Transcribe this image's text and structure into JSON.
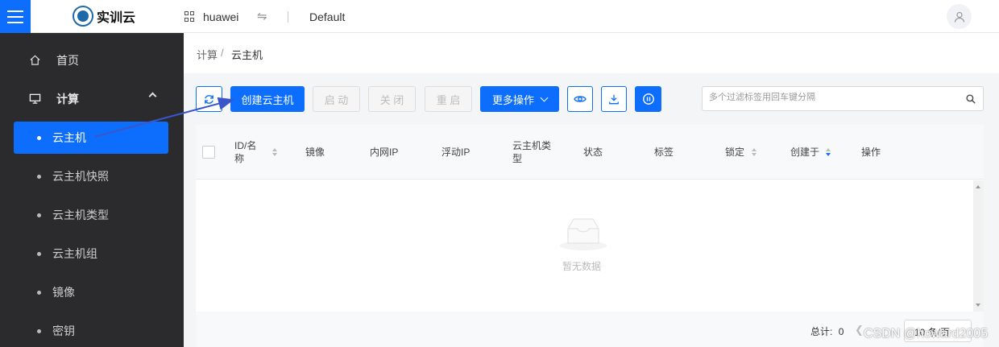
{
  "header": {
    "logo_text": "实训云",
    "project": "huawei",
    "swap_glyph": "⇋",
    "region": "Default"
  },
  "sidebar": {
    "top_items": [
      {
        "label": "首页",
        "icon": "home-icon"
      },
      {
        "label": "计算",
        "icon": "monitor-icon",
        "expanded": true
      }
    ],
    "sub_items": [
      {
        "label": "云主机",
        "active": true
      },
      {
        "label": "云主机快照"
      },
      {
        "label": "云主机类型"
      },
      {
        "label": "云主机组"
      },
      {
        "label": "镜像"
      },
      {
        "label": "密钥"
      }
    ]
  },
  "breadcrumb": {
    "items": [
      "计算",
      "云主机"
    ],
    "separator": "/"
  },
  "toolbar": {
    "refresh_icon": "refresh-icon",
    "create_label": "创建云主机",
    "start_label": "启 动",
    "stop_label": "关 闭",
    "restart_label": "重 启",
    "more_label": "更多操作",
    "eye_icon": "eye-icon",
    "download_icon": "download-icon",
    "power_icon": "power-icon"
  },
  "search": {
    "placeholder": "多个过滤标签用回车键分隔"
  },
  "table": {
    "columns": [
      {
        "label": "ID/名",
        "label2": "称",
        "sortable": true
      },
      {
        "label": "镜像"
      },
      {
        "label": "内网IP"
      },
      {
        "label": "浮动IP"
      },
      {
        "label": "云主机类",
        "label2": "型"
      },
      {
        "label": "状态"
      },
      {
        "label": "标签"
      },
      {
        "label": "锁定",
        "sortable": true
      },
      {
        "label": "创建于",
        "sortable": true,
        "sort": "desc"
      },
      {
        "label": "操作"
      }
    ],
    "empty_text": "暂无数据"
  },
  "footer": {
    "total_label": "总计:",
    "total_value": "0",
    "page_size": "10 条/页"
  },
  "watermark": "CSDN @howard2005",
  "colors": {
    "accent": "#0d6efd",
    "sidebar_bg": "#2b2b2d"
  }
}
